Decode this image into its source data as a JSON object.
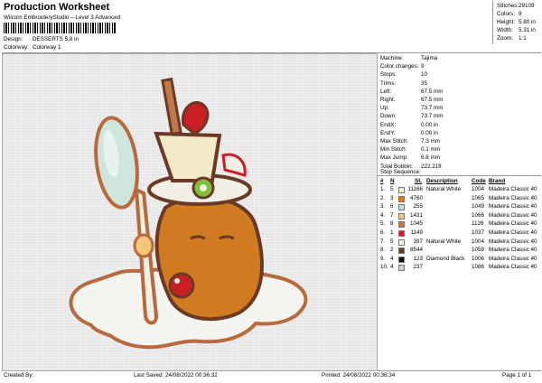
{
  "header": {
    "title": "Production Worksheet",
    "subtitle": "Wilcom EmbroideryStudio – Level 3 Advanced",
    "design_label": "Design:",
    "design_value": "DESSERTS 5,8 in",
    "colorway_label": "Colorway:",
    "colorway_value": "Colorway 1"
  },
  "summary": {
    "stitches_label": "Stitches:",
    "stitches_value": "29109",
    "colors_label": "Colors:",
    "colors_value": "9",
    "height_label": "Height:",
    "height_value": "5.80 in",
    "width_label": "Width:",
    "width_value": "5.31 in",
    "zoom_label": "Zoom:",
    "zoom_value": "1:1"
  },
  "machine_info": [
    {
      "label": "Machine:",
      "value": "Tajima"
    },
    {
      "label": "Color changes:",
      "value": "9"
    },
    {
      "label": "Stops:",
      "value": "10"
    },
    {
      "label": "Trims:",
      "value": "35"
    },
    {
      "label": "Left:",
      "value": "67.5 mm"
    },
    {
      "label": "Right:",
      "value": "67.5 mm"
    },
    {
      "label": "Up:",
      "value": "73.7 mm"
    },
    {
      "label": "Down:",
      "value": "73.7 mm"
    },
    {
      "label": "EndX:",
      "value": "0.00 in"
    },
    {
      "label": "EndY:",
      "value": "0.00 in"
    },
    {
      "label": "Max Stitch:",
      "value": "7.3 mm"
    },
    {
      "label": "Min Stitch:",
      "value": "0.1 mm"
    },
    {
      "label": "Max Jump:",
      "value": "6.8 mm"
    },
    {
      "label": "Total Bobbin:",
      "value": "222.21ft"
    }
  ],
  "stop_sequence": {
    "title": "Stop Sequence:",
    "headers": {
      "num": "#",
      "n": "N",
      "st": "St.",
      "description": "Description",
      "code": "Code",
      "brand": "Brand"
    },
    "rows": [
      {
        "num": "1.",
        "n": "5",
        "color": "#f2f0e6",
        "st": "11166",
        "description": "Natural White",
        "code": "1004",
        "brand": "Madeira Classic 40"
      },
      {
        "num": "2.",
        "n": "3",
        "color": "#e07a1a",
        "st": "4760",
        "description": "",
        "code": "1065",
        "brand": "Madeira Classic 40"
      },
      {
        "num": "3.",
        "n": "6",
        "color": "#bfe0dc",
        "st": "255",
        "description": "",
        "code": "1049",
        "brand": "Madeira Classic 40"
      },
      {
        "num": "4.",
        "n": "7",
        "color": "#f4c77a",
        "st": "1431",
        "description": "",
        "code": "1066",
        "brand": "Madeira Classic 40"
      },
      {
        "num": "5.",
        "n": "8",
        "color": "#c07a4a",
        "st": "1045",
        "description": "",
        "code": "1126",
        "brand": "Madeira Classic 40"
      },
      {
        "num": "6.",
        "n": "1",
        "color": "#c81e24",
        "st": "1149",
        "description": "",
        "code": "1037",
        "brand": "Madeira Classic 40"
      },
      {
        "num": "7.",
        "n": "5",
        "color": "#f2f0e6",
        "st": "397",
        "description": "Natural White",
        "code": "1004",
        "brand": "Madeira Classic 40"
      },
      {
        "num": "8.",
        "n": "2",
        "color": "#6b3a26",
        "st": "8544",
        "description": "",
        "code": "1058",
        "brand": "Madeira Classic 40"
      },
      {
        "num": "9.",
        "n": "4",
        "color": "#111111",
        "st": "123",
        "description": "Diamond Black",
        "code": "1006",
        "brand": "Madeira Classic 40"
      },
      {
        "num": "10.",
        "n": "4",
        "color": "#cfcfcf",
        "st": "237",
        "description": "",
        "code": "1086",
        "brand": "Madeira Classic 40"
      }
    ]
  },
  "footer": {
    "created_by": "Created By:",
    "last_saved": "Last Saved: 24/08/2022 00:36:32",
    "printed": "Printed: 24/08/2022 00:36:34",
    "page": "Page 1 of 1"
  }
}
